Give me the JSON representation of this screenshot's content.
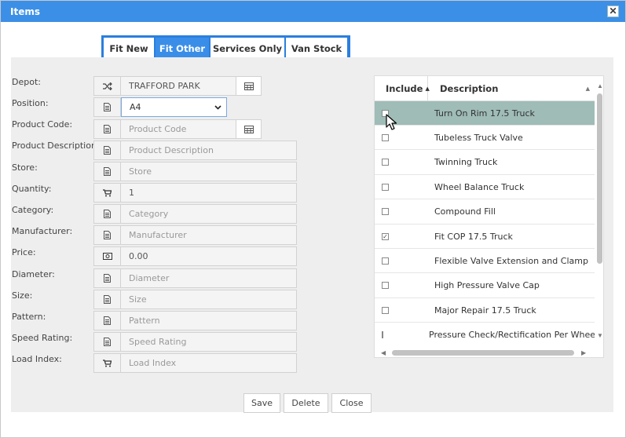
{
  "window": {
    "title": "Items",
    "close_glyph": "✕"
  },
  "tabs": [
    {
      "label": "Fit New",
      "active": false
    },
    {
      "label": "Fit Other",
      "active": true
    },
    {
      "label": "Services Only",
      "active": false
    },
    {
      "label": "Van Stock",
      "active": false
    }
  ],
  "form": {
    "depot": {
      "label": "Depot:",
      "value": "TRAFFORD PARK",
      "icon": "shuffle-icon"
    },
    "position": {
      "label": "Position:",
      "value": "A4",
      "icon": "document-icon"
    },
    "product_code": {
      "label": "Product Code:",
      "placeholder": "Product Code",
      "icon": "document-icon"
    },
    "product_description": {
      "label": "Product Description:",
      "placeholder": "Product Description",
      "icon": "document-icon"
    },
    "store": {
      "label": "Store:",
      "placeholder": "Store",
      "icon": "document-icon"
    },
    "quantity": {
      "label": "Quantity:",
      "value": "1",
      "icon": "cart-icon"
    },
    "category": {
      "label": "Category:",
      "placeholder": "Category",
      "icon": "document-icon"
    },
    "manufacturer": {
      "label": "Manufacturer:",
      "placeholder": "Manufacturer",
      "icon": "document-icon"
    },
    "price": {
      "label": "Price:",
      "value": "0.00",
      "icon": "money-icon"
    },
    "diameter": {
      "label": "Diameter:",
      "placeholder": "Diameter",
      "icon": "document-icon"
    },
    "size": {
      "label": "Size:",
      "placeholder": "Size",
      "icon": "document-icon"
    },
    "pattern": {
      "label": "Pattern:",
      "placeholder": "Pattern",
      "icon": "document-icon"
    },
    "speed_rating": {
      "label": "Speed Rating:",
      "placeholder": "Speed Rating",
      "icon": "document-icon"
    },
    "load_index": {
      "label": "Load Index:",
      "placeholder": "Load Index",
      "icon": "cart-icon"
    }
  },
  "grid": {
    "headers": {
      "include": "Include",
      "description": "Description"
    },
    "rows": [
      {
        "include": false,
        "description": "Turn On Rim 17.5 Truck",
        "highlighted": true
      },
      {
        "include": false,
        "description": "Tubeless Truck Valve"
      },
      {
        "include": false,
        "description": "Twinning Truck"
      },
      {
        "include": false,
        "description": "Wheel Balance Truck"
      },
      {
        "include": false,
        "description": "Compound Fill"
      },
      {
        "include": true,
        "description": "Fit COP 17.5 Truck"
      },
      {
        "include": false,
        "description": "Flexible Valve Extension and Clamp"
      },
      {
        "include": false,
        "description": "High Pressure Valve Cap"
      },
      {
        "include": false,
        "description": "Major Repair 17.5 Truck"
      },
      {
        "include": false,
        "description": "Pressure Check/Rectification Per Wheel"
      }
    ]
  },
  "footer": {
    "save": "Save",
    "delete": "Delete",
    "close": "Close"
  },
  "colors": {
    "titlebar": "#3c8fe6",
    "tab_active": "#3a8ee8",
    "row_highlight": "#9fbcb7",
    "panel": "#eeeeee"
  }
}
